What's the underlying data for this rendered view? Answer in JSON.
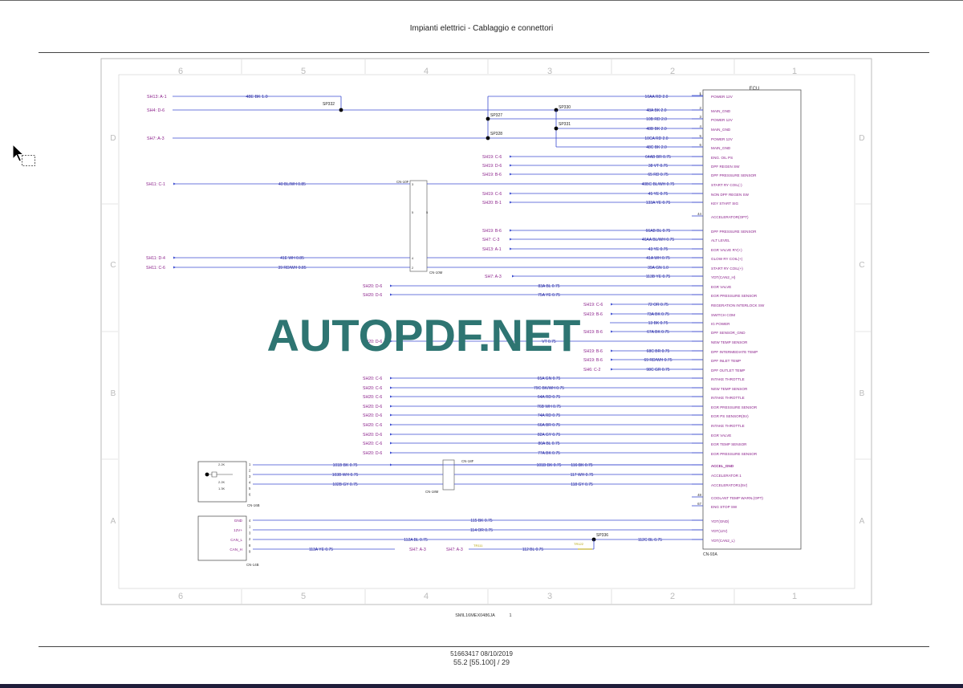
{
  "header": {
    "title": "Impianti elettrici - Cablaggio e connettori"
  },
  "footer": {
    "doc_ref": "51663417 08/10/2019",
    "page": "55.2 [55.100] / 29"
  },
  "diagram": {
    "drawing_code": "SMIL16MEX0486JA",
    "drawing_sheet": "1",
    "watermark": "AUTOPDF.NET",
    "zone_columns": [
      "6",
      "5",
      "4",
      "3",
      "2",
      "1"
    ],
    "zone_rows": [
      "D",
      "C",
      "B",
      "A"
    ],
    "ecu_label": "ECU",
    "connector_ecu": "CN-93A",
    "splices": [
      "SP332",
      "SP327",
      "SP330",
      "SP331",
      "SP328",
      "SP336"
    ],
    "connectors": [
      "CN-10F",
      "CN-10M",
      "CN-18F",
      "CN-18M",
      "CN-16B",
      "CN-14B"
    ],
    "sensor_box": {
      "label1": "2.2K",
      "label2": "2.2K",
      "label3": "1.3K",
      "pins": [
        "1",
        "2",
        "3",
        "4",
        "5",
        "6"
      ]
    },
    "can_box": {
      "labels": [
        "GND",
        "12V+",
        "CAN_L",
        "CAN_H"
      ],
      "pins": [
        "4",
        "1",
        "3",
        "2",
        "8",
        "9"
      ]
    },
    "resistor_labels": [
      "TR111",
      "TR122"
    ],
    "wires": [
      {
        "ref": "SH13: A-1",
        "wire": "48E  BK  1.0",
        "pin": ""
      },
      {
        "ref": "SH4: D-6",
        "wire": "",
        "pin": ""
      },
      {
        "ref": "",
        "wire": "10AA  RD  2.0",
        "pin": "1",
        "func": "POWER 12V"
      },
      {
        "ref": "",
        "wire": "48A  BK  2.0",
        "pin": "2",
        "func": "MAIN_GND"
      },
      {
        "ref": "",
        "wire": "10B  RD  2.0",
        "pin": "3",
        "func": "POWER 12V"
      },
      {
        "ref": "",
        "wire": "48B  BK  2.0",
        "pin": "4",
        "func": "MAIN_GND"
      },
      {
        "ref": "SH7: A-3",
        "wire": "10CA  RD  2.0",
        "pin": "5",
        "func": "POWER 12V"
      },
      {
        "ref": "",
        "wire": "48C  BK  2.0",
        "pin": "6",
        "func": "MAIN_GND"
      },
      {
        "ref": "SH19: C-6",
        "wire": "64AB  BR  0.75",
        "pin": "",
        "func": "ENG. OIL PS"
      },
      {
        "ref": "SH19: D-6",
        "wire": "38  VT  0.75",
        "pin": "",
        "func": "DPF REGEN SW"
      },
      {
        "ref": "SH19: B-6",
        "wire": "65  RD  0.75",
        "pin": "",
        "func": "DPF PRESSURE SENSOR"
      },
      {
        "ref": "SH11: C-1",
        "wire": "40  BL/WH  0.85",
        "wire2": "40BC  BL/WH  0.75",
        "pin": "",
        "func": "START RY COIL(-)"
      },
      {
        "ref": "SH19: C-6",
        "wire": "45  YE  0.75",
        "pin": "",
        "func": "NON DPF REGEN SW"
      },
      {
        "ref": "SH20: B-1",
        "wire": "133A  YE  0.75",
        "pin": "",
        "func": "KEY START SIG"
      },
      {
        "ref": "",
        "wire": "",
        "pin": "44",
        "func": "ACCELERATOR(OPT)"
      },
      {
        "ref": "SH19: B-6",
        "wire": "66AB  BL  0.75",
        "pin": "",
        "func": "DPF PRESSURE SENSOR"
      },
      {
        "ref": "SH7: C-3",
        "wire": "46AA  BL/WH  0.75",
        "pin": "",
        "func": "ALT LEVEL"
      },
      {
        "ref": "SH13: A-1",
        "wire": "43  YE  0.75",
        "pin": "",
        "func": "EGR VALVE RY(+)"
      },
      {
        "ref": "SH11: D-4",
        "wire": "41E  WH  0.85",
        "wire2": "41A  WH  0.75",
        "pin": "",
        "func": "GLOW RY COIL(+)"
      },
      {
        "ref": "SH11: C-6",
        "wire": "39  RD/WH  0.85",
        "wire2": "39A  GN  1.0",
        "pin": "",
        "func": "START RY COIL(+)"
      },
      {
        "ref": "SH7: A-3",
        "wire": "113B  YE  0.75",
        "pin": "",
        "func": "YDT(CAN2_H)"
      },
      {
        "ref": "SH20: D-6",
        "wire": "83A  BL  0.75",
        "pin": "",
        "func": "EGR VALVE"
      },
      {
        "ref": "SH20: D-6",
        "wire": "75A  YE  0.75",
        "pin": "",
        "func": "EGR PRESSURE SENSOR"
      },
      {
        "ref": "SH19: C-6",
        "wire": "72  OR  0.75",
        "pin": "",
        "func": "REGERATION INTERLOCK SW"
      },
      {
        "ref": "SH19: B-6",
        "wire": "73A  BK  0.75",
        "pin": "",
        "func": "SWITCH COM"
      },
      {
        "ref": "",
        "wire": "13  BK  0.75",
        "pin": "",
        "func": "IG POWER"
      },
      {
        "ref": "SH19: B-6",
        "wire": "67A  BK  0.75",
        "pin": "",
        "func": "DPF SENSOR_GND"
      },
      {
        "ref": "SH20: D-6",
        "wire": "VT  0.75",
        "pin": "",
        "func": "NEW TEMP SENSOR"
      },
      {
        "ref": "SH19: B-6",
        "wire": "68C  BR  0.75",
        "pin": "",
        "func": "DPF INTERMEDIATE TEMP"
      },
      {
        "ref": "SH19: B-6",
        "wire": "69  RD/WH  0.75",
        "pin": "",
        "func": "DPF INLET TEMP"
      },
      {
        "ref": "SH6: C-2",
        "wire": "98C  GR  0.75",
        "pin": "",
        "func": "DPF OUTLET TEMP"
      },
      {
        "ref": "SH20: C-6",
        "wire": "65A  GN  0.75",
        "pin": "",
        "func": "INTAKE THROTTLE"
      },
      {
        "ref": "SH20: C-6",
        "wire": "79C  BK/WH  0.75",
        "pin": "",
        "func": "NEW TEMP SENSOR"
      },
      {
        "ref": "SH20: C-6",
        "wire": "64A  RD  0.75",
        "pin": "",
        "func": "INTAKE THROTTLE"
      },
      {
        "ref": "SH20: D-6",
        "wire": "76B  WH  0.75",
        "pin": "",
        "func": "EGR PRESSURE SENSOR"
      },
      {
        "ref": "SH20: D-6",
        "wire": "74A  RD  0.75",
        "pin": "",
        "func": "EGR PS SENSOR(5V)"
      },
      {
        "ref": "SH20: C-6",
        "wire": "66A  BR  0.75",
        "pin": "",
        "func": "INTAKE THROTTLE"
      },
      {
        "ref": "SH20: D-6",
        "wire": "82A  GY  0.75",
        "pin": "",
        "func": "EGR VALVE"
      },
      {
        "ref": "SH20: C-6",
        "wire": "80A  BL  0.75",
        "pin": "",
        "func": "EGR TEMP SENSOR"
      },
      {
        "ref": "SH20: D-6",
        "wire": "77A  BK  0.75",
        "pin": "",
        "func": "EGR PRESSURE SENSOR"
      },
      {
        "ref": "",
        "wire": "101B  BK  0.75",
        "wire2": "116  BK  0.75",
        "pin": "",
        "func": "ACCEL_GND"
      },
      {
        "ref": "",
        "wire": "103B  WH  0.75",
        "wire2": "117  WH  0.75",
        "pin": "",
        "func": "ACCELERATOR 1"
      },
      {
        "ref": "",
        "wire": "102B  GY  0.75",
        "wire2": "118  GY  0.75",
        "pin": "",
        "func": "ACCELERATOR1(5V)"
      },
      {
        "ref": "",
        "wire": "",
        "pin": "48",
        "func": "COOLANT TEMP WARN.(OPT)"
      },
      {
        "ref": "",
        "wire": "",
        "pin": "67",
        "func": "ENG STOP SW"
      },
      {
        "ref": "",
        "wire": "115  BK  0.75",
        "pin": "",
        "func": "YDT(GND)"
      },
      {
        "ref": "",
        "wire": "114  OR  0.75",
        "pin": "",
        "func": "YDT(12V)"
      },
      {
        "ref": "",
        "wire": "112A  BL  0.75",
        "wire2": "112C  BL  0.75",
        "pin": "",
        "func": "YDT(CAN2_L)"
      },
      {
        "ref": "SH7: A-3",
        "wire": "113A  YE  0.75",
        "pin": ""
      },
      {
        "ref": "SH7: A-3",
        "wire": "112  BL  0.75",
        "pin": ""
      }
    ],
    "colors": {
      "line": "#3b4bd0",
      "ref": "#8a1f8a",
      "text": "#2a2aa0",
      "watermark": "#2e7572"
    }
  }
}
